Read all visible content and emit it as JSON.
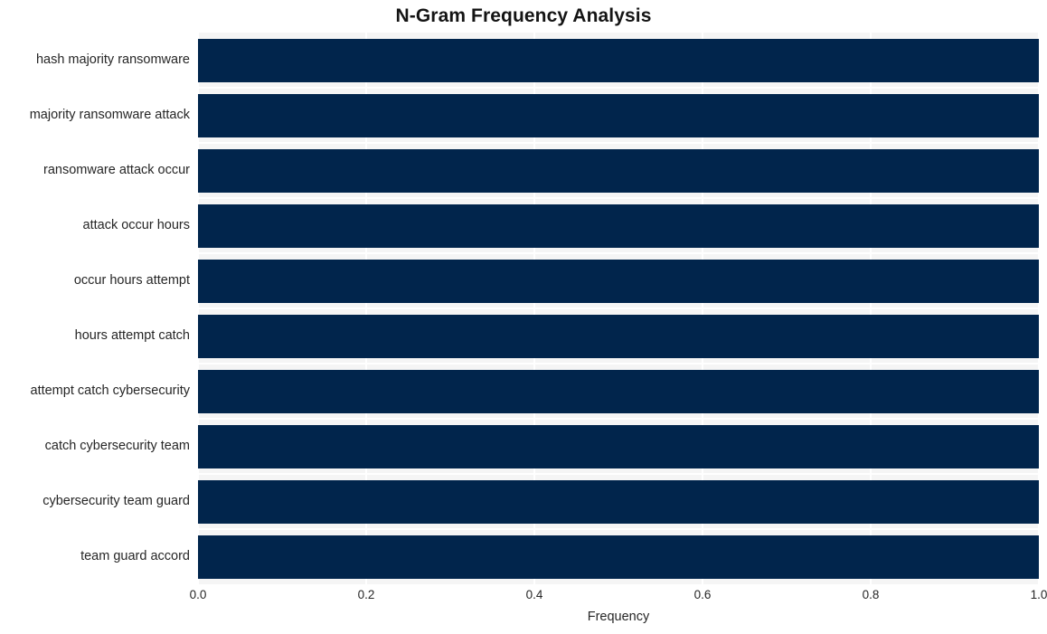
{
  "chart_data": {
    "type": "bar",
    "orientation": "horizontal",
    "title": "N-Gram Frequency Analysis",
    "xlabel": "Frequency",
    "ylabel": "",
    "categories": [
      "hash majority ransomware",
      "majority ransomware attack",
      "ransomware attack occur",
      "attack occur hours",
      "occur hours attempt",
      "hours attempt catch",
      "attempt catch cybersecurity",
      "catch cybersecurity team",
      "cybersecurity team guard",
      "team guard accord"
    ],
    "values": [
      1.0,
      1.0,
      1.0,
      1.0,
      1.0,
      1.0,
      1.0,
      1.0,
      1.0,
      1.0
    ],
    "xlim": [
      0.0,
      1.0
    ],
    "xticks": [
      "0.0",
      "0.2",
      "0.4",
      "0.6",
      "0.8",
      "1.0"
    ],
    "xtick_values": [
      0.0,
      0.2,
      0.4,
      0.6,
      0.8,
      1.0
    ],
    "grid": true,
    "grid_color": "#ffffff",
    "legend": null,
    "bar_color": "#01254c",
    "plot_background": "#f5f5f5",
    "figure_background": "#ffffff"
  }
}
